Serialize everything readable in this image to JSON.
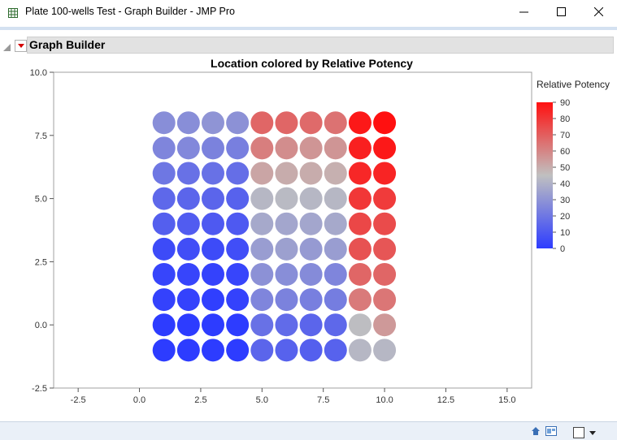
{
  "window": {
    "title": "Plate 100-wells Test - Graph Builder - JMP Pro"
  },
  "report": {
    "header": "Graph Builder"
  },
  "chart_data": {
    "type": "scatter",
    "title": "Location colored by Relative Potency",
    "xlabel": "",
    "ylabel": "",
    "xlim": [
      -3.5,
      16
    ],
    "ylim": [
      -2.5,
      10
    ],
    "x_ticks": [
      "-2.5",
      "0.0",
      "2.5",
      "5.0",
      "7.5",
      "10.0",
      "12.5",
      "15.0"
    ],
    "x_tick_values": [
      -2.5,
      0,
      2.5,
      5,
      7.5,
      10,
      12.5,
      15
    ],
    "y_ticks": [
      "-2.5",
      "0.0",
      "2.5",
      "5.0",
      "7.5",
      "10.0"
    ],
    "y_tick_values": [
      -2.5,
      0,
      2.5,
      5,
      7.5,
      10
    ],
    "grid": false,
    "color_legend": {
      "title": "Relative Potency",
      "ticks": [
        "90",
        "80",
        "70",
        "60",
        "50",
        "40",
        "30",
        "20",
        "10",
        "0"
      ],
      "min": 0,
      "max": 90,
      "placement": "right",
      "colors": [
        "#2d3cff",
        "#c0c0c0",
        "#ff1010"
      ]
    },
    "x": [
      1,
      2,
      3,
      4,
      5,
      6,
      7,
      8,
      9,
      10
    ],
    "y": [
      8,
      7,
      6,
      5,
      4,
      3,
      2,
      1,
      0,
      -1
    ],
    "potency": [
      [
        28,
        28,
        30,
        29,
        68,
        68,
        67,
        65,
        88,
        90
      ],
      [
        25,
        26,
        24,
        23,
        62,
        58,
        56,
        56,
        86,
        88
      ],
      [
        20,
        18,
        18,
        17,
        52,
        50,
        50,
        49,
        84,
        85
      ],
      [
        15,
        14,
        14,
        13,
        42,
        43,
        42,
        42,
        80,
        79
      ],
      [
        12,
        11,
        10,
        10,
        37,
        36,
        36,
        37,
        76,
        75
      ],
      [
        5,
        6,
        5,
        6,
        33,
        34,
        32,
        33,
        73,
        72
      ],
      [
        3,
        3,
        2,
        3,
        29,
        28,
        27,
        25,
        68,
        68
      ],
      [
        2,
        2,
        1,
        2,
        25,
        24,
        23,
        22,
        63,
        64
      ],
      [
        0,
        0,
        0,
        0,
        18,
        16,
        14,
        15,
        44,
        55
      ],
      [
        0,
        0,
        0,
        0,
        14,
        13,
        12,
        13,
        42,
        42
      ]
    ]
  },
  "status_bar": {
    "icons": [
      "home-icon",
      "layout-icon",
      "square-icon",
      "dropdown-icon"
    ]
  }
}
